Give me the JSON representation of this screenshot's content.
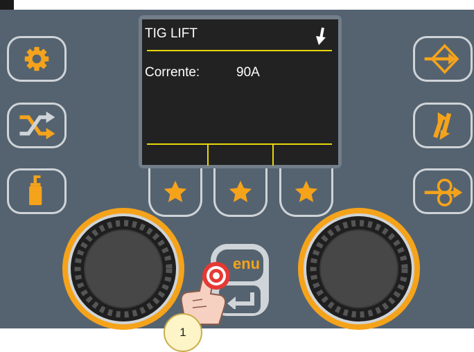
{
  "screen": {
    "mode_title": "TIG LIFT",
    "current_label": "Corrente:",
    "current_value": "90A",
    "trigger_icon": "arrow-down-icon"
  },
  "side_buttons": {
    "left": [
      "gear-icon",
      "shuffle-icon",
      "spray-can-icon"
    ],
    "right": [
      "diamond-arrow-icon",
      "double-arrow-icon",
      "wire-feed-icon"
    ]
  },
  "function_keys": [
    "star-icon",
    "star-icon",
    "star-icon"
  ],
  "menu_button": {
    "label": "enu",
    "icon": "return-icon"
  },
  "step_badge": "1",
  "colors": {
    "panel": "#556370",
    "accent": "#f5a31b",
    "screen_line": "#e9d80a",
    "button_border": "#cfd4d8",
    "press_marker": "#e53935"
  }
}
